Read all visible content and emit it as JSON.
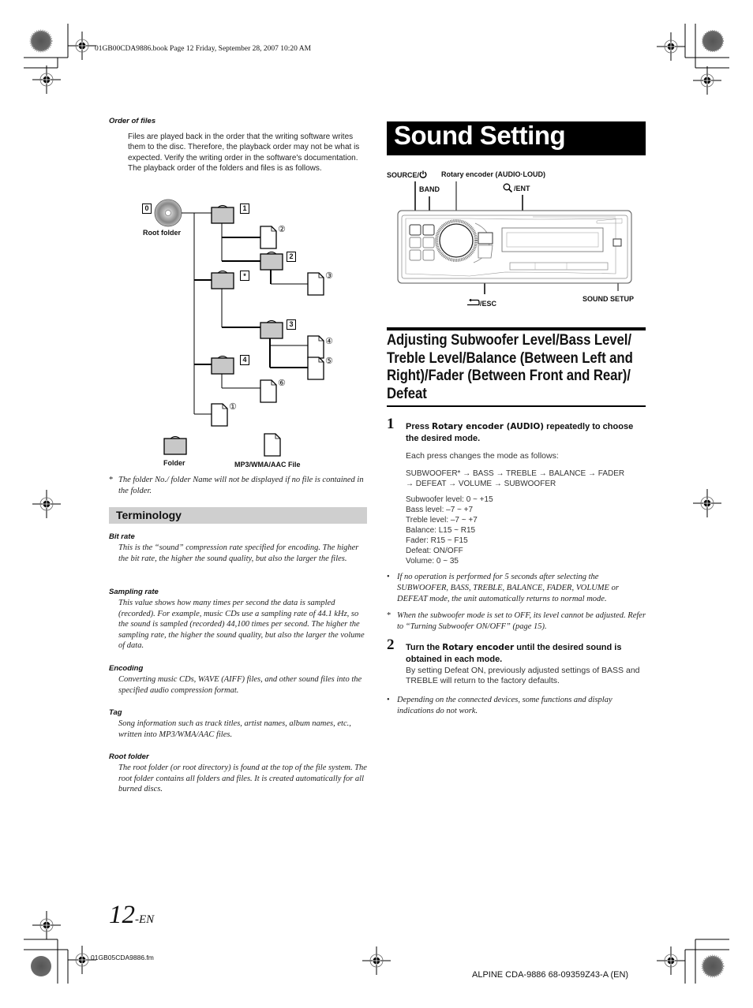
{
  "header": {
    "book_line": "01GB00CDA9886.book  Page 12  Friday, September 28, 2007  10:20 AM"
  },
  "left": {
    "order_of_files": {
      "title": "Order of files",
      "body": "Files are played back in the order that the writing software writes them to the disc. Therefore, the playback order may not be what is expected. Verify the writing order in the software's documentation. The playback order of the folders and files is as follows."
    },
    "diagram": {
      "root_number": "0",
      "root_label": "Root folder",
      "folder_numbers": [
        "1",
        "2",
        "*",
        "3",
        "4"
      ],
      "file_numbers": [
        "②",
        "③",
        "④",
        "⑤",
        "⑥",
        "①"
      ],
      "legend_folder": "Folder",
      "legend_file": "MP3/WMA/AAC File"
    },
    "footnote": {
      "mark": "*",
      "text": "The folder No./ folder Name will not be displayed if no file is contained in the folder."
    },
    "terminology": {
      "title": "Terminology",
      "items": [
        {
          "term": "Bit rate",
          "definition": "This is the “sound” compression rate specified for encoding. The higher the bit rate, the higher the sound quality, but also the larger the files."
        },
        {
          "term": "Sampling rate",
          "definition": "This value shows how many times per second the data is sampled (recorded). For example, music CDs use a sampling rate of 44.1 kHz, so the sound is sampled (recorded) 44,100 times per second. The higher the sampling rate, the higher the sound quality, but also the larger the volume of data."
        },
        {
          "term": "Encoding",
          "definition": "Converting music CDs, WAVE (AIFF) files, and other sound files into the specified audio compression format."
        },
        {
          "term": "Tag",
          "definition": "Song information such as track titles, artist names, album names, etc., written into MP3/WMA/AAC files."
        },
        {
          "term": "Root folder",
          "definition": "The root folder (or root directory) is found at the top of the file system. The root folder contains all folders and files. It is created automatically for all burned discs."
        }
      ]
    }
  },
  "right": {
    "section_title": "Sound Setting",
    "device_labels": {
      "source": "SOURCE/",
      "rotary": "Rotary encoder (AUDIO·LOUD)",
      "band": "BAND",
      "ent": "/ENT",
      "esc": "/ESC",
      "sound_setup": "SOUND SETUP"
    },
    "adjust_title": "Adjusting Subwoofer Level/Bass Level/ Treble Level/Balance (Between Left and Right)/Fader (Between Front and Rear)/ Defeat",
    "step1": {
      "number": "1",
      "head_pre": "Press ",
      "head_kw": "Rotary encoder (AUDIO)",
      "head_post": " repeatedly to choose the desired mode.",
      "intro": "Each press changes the mode as follows:",
      "sequence_line1": "SUBWOOFER* → BASS → TREBLE → BALANCE → FADER",
      "sequence_line2": "→ DEFEAT → VOLUME → SUBWOOFER",
      "ranges": [
        "Subwoofer level: 0 ~ +15",
        "Bass level: –7 ~ +7",
        "Treble level: –7 ~ +7",
        "Balance: L15 ~ R15",
        "Fader: R15 ~ F15",
        "Defeat: ON/OFF",
        "Volume: 0 ~ 35"
      ]
    },
    "note1": {
      "mark": "•",
      "text": "If no operation is performed for 5 seconds after selecting the SUBWOOFER, BASS, TREBLE, BALANCE, FADER, VOLUME or DEFEAT mode, the unit automatically returns to normal mode."
    },
    "note2": {
      "mark": "*",
      "text": "When the subwoofer mode is set to OFF, its level cannot be adjusted. Refer to “Turning Subwoofer ON/OFF” (page 15)."
    },
    "step2": {
      "number": "2",
      "head_pre": "Turn the ",
      "head_kw": "Rotary encoder",
      "head_post": " until the desired sound is obtained in each mode.",
      "body": "By setting Defeat ON, previously adjusted settings of BASS and TREBLE will return to the factory defaults."
    },
    "note3": {
      "mark": "•",
      "text": "Depending on the connected devices, some functions and display indications do not work."
    }
  },
  "footer": {
    "page_number": "12",
    "page_suffix": "-EN",
    "file_name": "01GB05CDA9886.fm",
    "model_line": "ALPINE CDA-9886 68-09359Z43-A (EN)"
  }
}
